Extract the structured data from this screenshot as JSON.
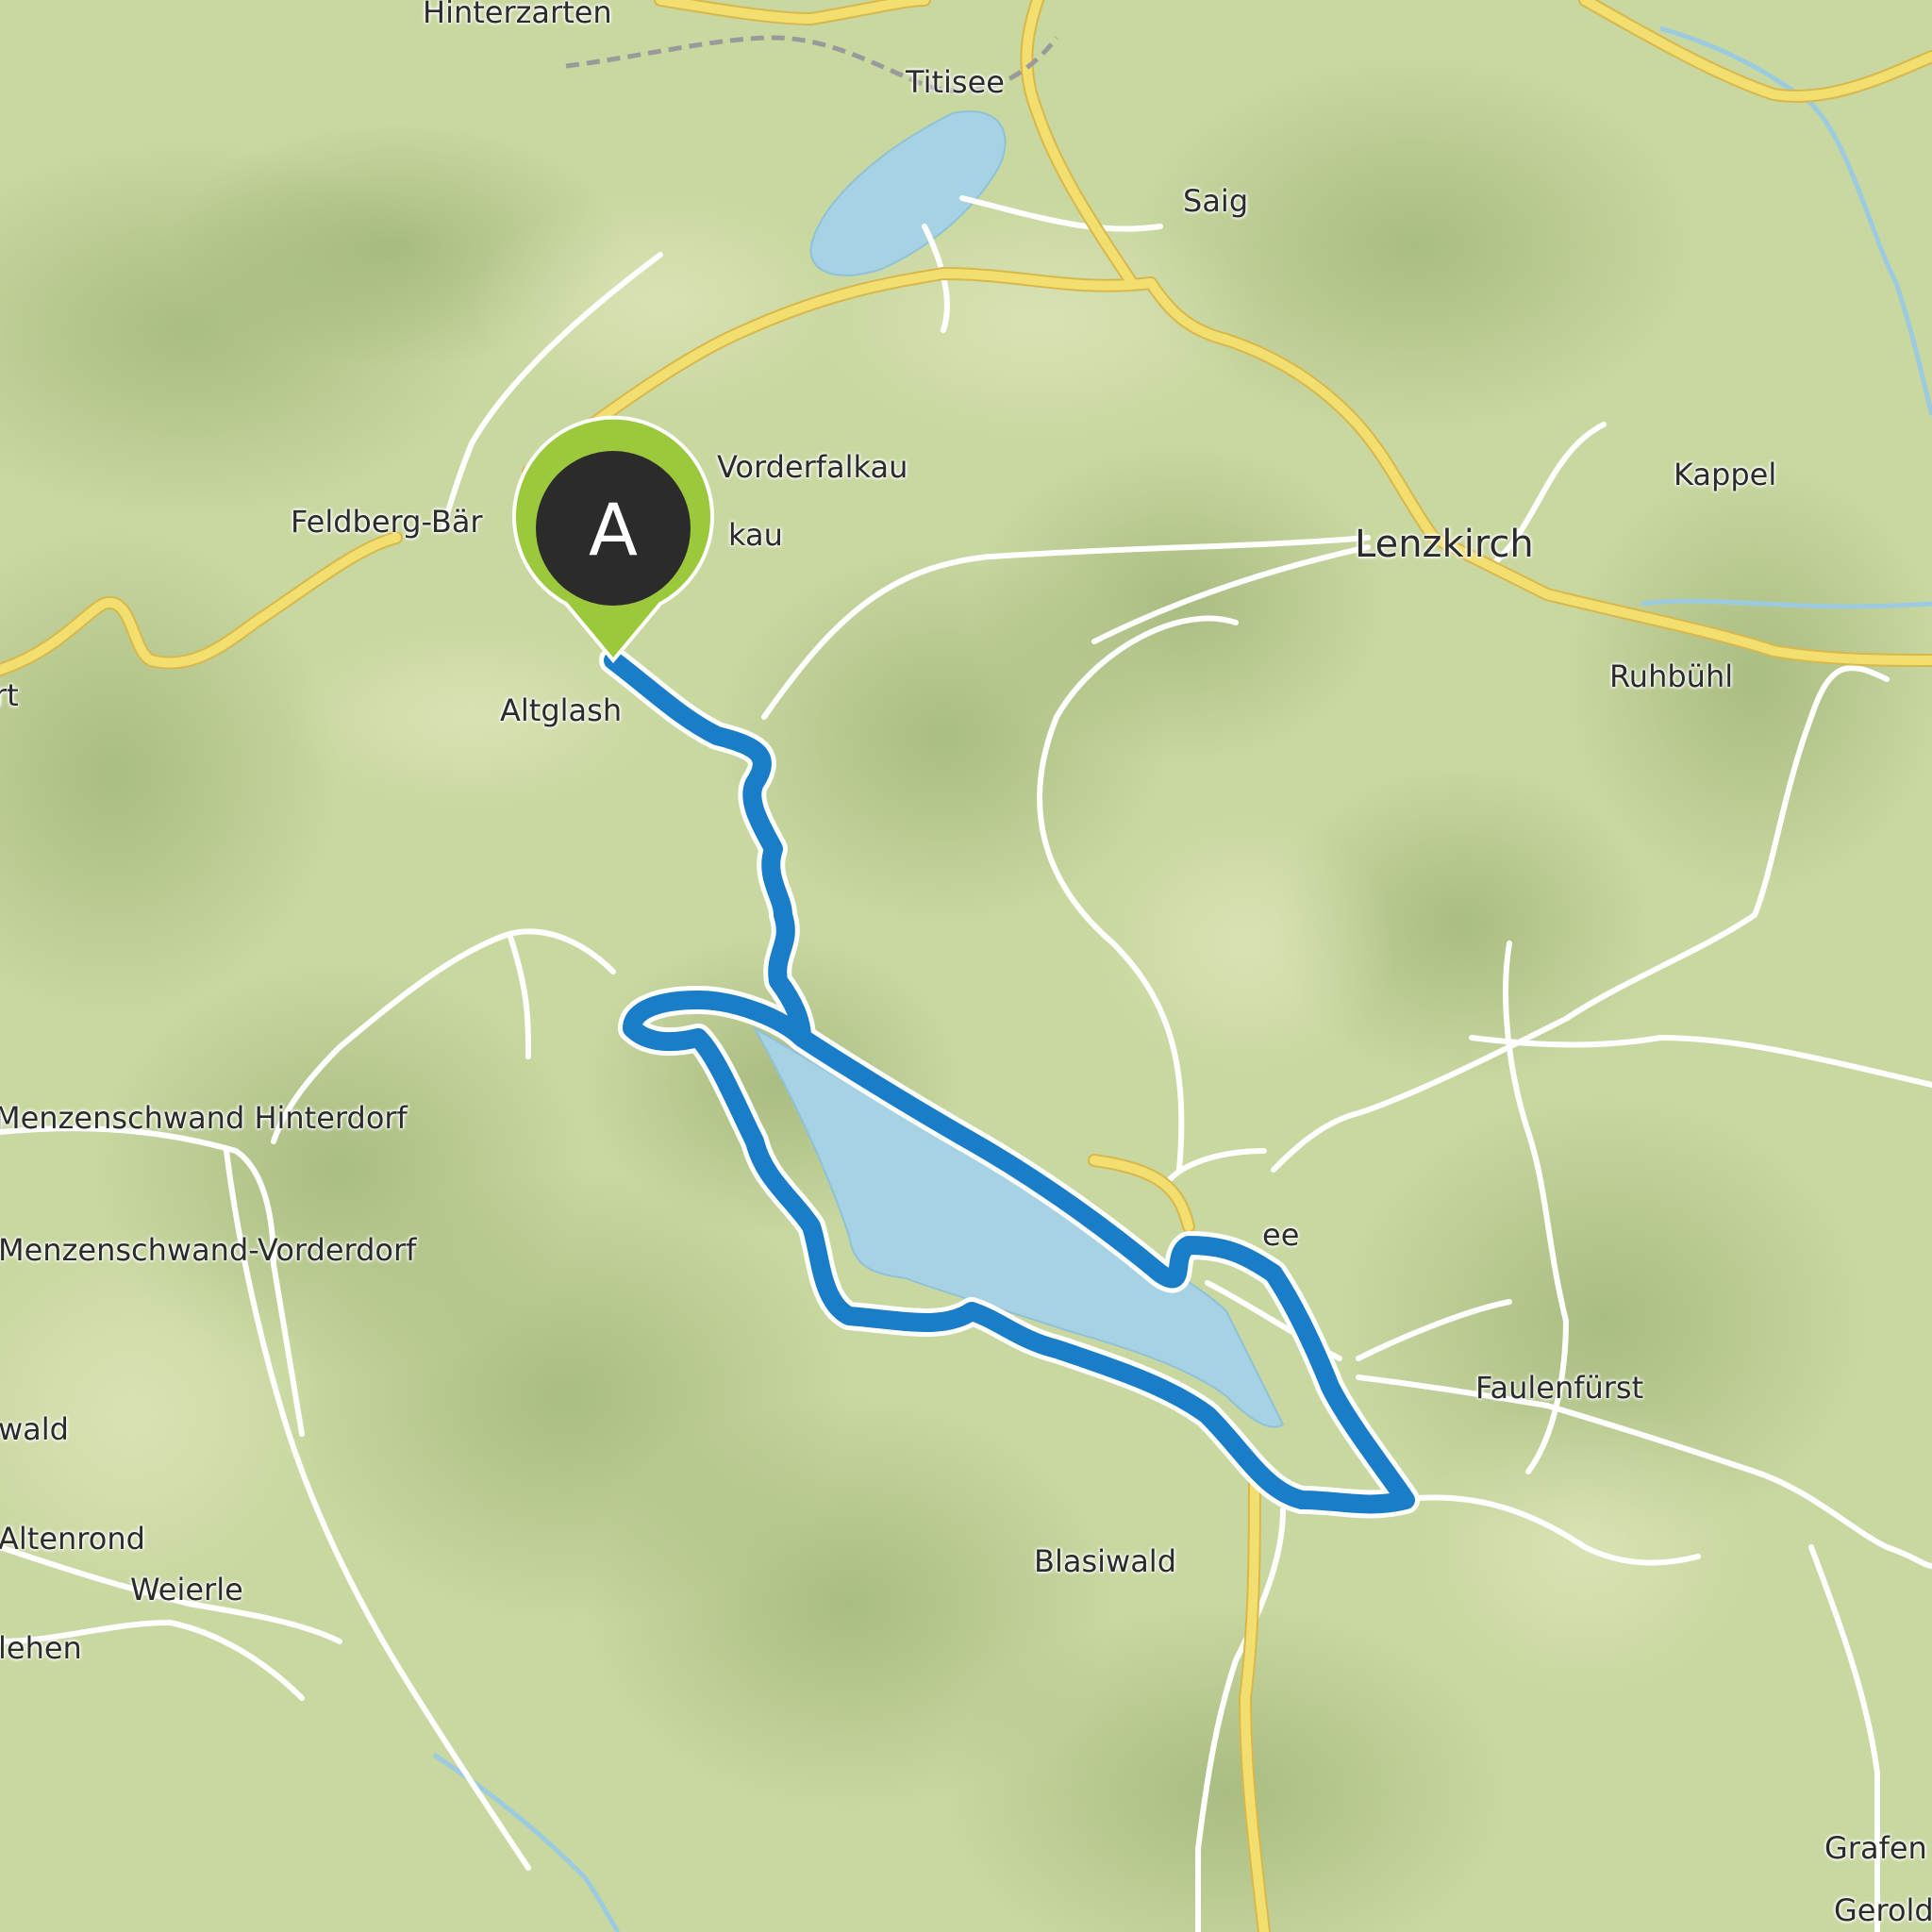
{
  "map": {
    "colors": {
      "terrain": "#c9d7a0",
      "water": "#a6d2e3",
      "road_minor": "#ffffff",
      "road_major": "#f3de70",
      "route": "#1a7dc8",
      "marker": "#9cc83c"
    },
    "start_marker": {
      "label": "A",
      "icon": "map-pin-icon"
    },
    "places": [
      {
        "id": "hinterzarten",
        "label": "Hinterzarten",
        "kind": "village"
      },
      {
        "id": "titisee",
        "label": "Titisee",
        "kind": "village"
      },
      {
        "id": "saig",
        "label": "Saig",
        "kind": "village"
      },
      {
        "id": "vorderfalkau",
        "label": "Vorderfalkau",
        "kind": "village"
      },
      {
        "id": "feldberg-baerental",
        "label": "Feldberg-Bär",
        "kind": "village"
      },
      {
        "id": "falkau",
        "label": "kau",
        "kind": "village"
      },
      {
        "id": "lenzkirch",
        "label": "Lenzkirch",
        "kind": "town"
      },
      {
        "id": "kappel",
        "label": "Kappel",
        "kind": "village"
      },
      {
        "id": "ruhbuehl",
        "label": "Ruhbühl",
        "kind": "village"
      },
      {
        "id": "altglashuetten",
        "label": "Altglash",
        "kind": "village"
      },
      {
        "id": "west-edge",
        "label": "rt",
        "kind": "village"
      },
      {
        "id": "menzenschwand-hinterdorf",
        "label": "Menzenschwand Hinterdorf",
        "kind": "village"
      },
      {
        "id": "menzenschwand-vorderdorf",
        "label": "Menzenschwand-Vorderdorf",
        "kind": "village"
      },
      {
        "id": "schluchsee",
        "label": "ee",
        "kind": "village"
      },
      {
        "id": "faulenfuerst",
        "label": "Faulenfürst",
        "kind": "village"
      },
      {
        "id": "wald",
        "label": "wald",
        "kind": "village"
      },
      {
        "id": "altenrond",
        "label": "Altenrond",
        "kind": "village"
      },
      {
        "id": "weierle",
        "label": "Weierle",
        "kind": "village"
      },
      {
        "id": "lehen",
        "label": "lehen",
        "kind": "village"
      },
      {
        "id": "blasiwald",
        "label": "Blasiwald",
        "kind": "village"
      },
      {
        "id": "grafen",
        "label": "Grafen",
        "kind": "village"
      },
      {
        "id": "gerold",
        "label": "Gerold",
        "kind": "village"
      }
    ]
  }
}
